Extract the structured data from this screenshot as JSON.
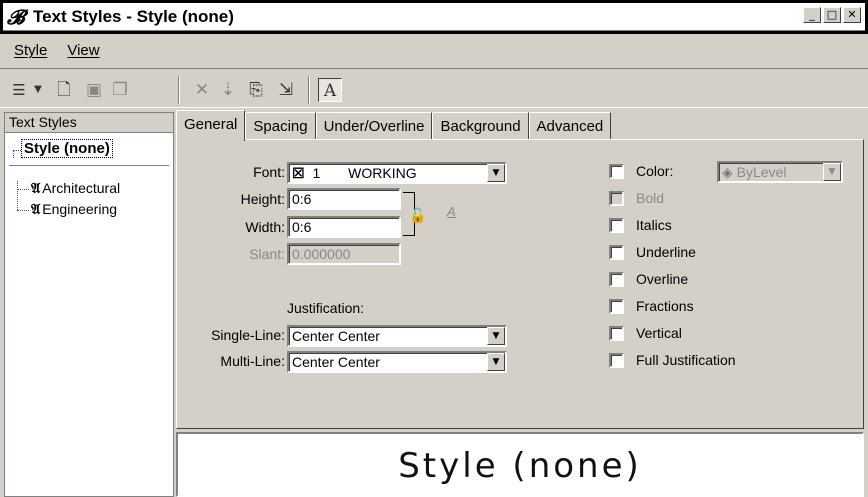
{
  "window": {
    "title": "Text Styles - Style (none)",
    "icon": "microstation-icon"
  },
  "menu": [
    {
      "label": "Style",
      "accel": "S"
    },
    {
      "label": "View",
      "accel": "V"
    }
  ],
  "tree": {
    "header": "Text Styles",
    "selected": "Style (none)",
    "items": [
      "Architectural",
      "Engineering"
    ]
  },
  "tabs": [
    "General",
    "Spacing",
    "Under/Overline",
    "Background",
    "Advanced"
  ],
  "general": {
    "font_label": "Font:",
    "font_number": "1",
    "font_name": "WORKING",
    "height_label": "Height:",
    "height_value": "0:6",
    "width_label": "Width:",
    "width_value": "0:6",
    "slant_label": "Slant:",
    "slant_value": "0.000000",
    "justification_label": "Justification:",
    "single_line_label": "Single-Line:",
    "single_line_value": "Center Center",
    "multi_line_label": "Multi-Line:",
    "multi_line_value": "Center Center",
    "color_value": "ByLevel"
  },
  "options": [
    {
      "label": "Color:",
      "checked": false,
      "enabled": true
    },
    {
      "label": "Bold",
      "checked": false,
      "enabled": false
    },
    {
      "label": "Italics",
      "checked": false,
      "enabled": true
    },
    {
      "label": "Underline",
      "checked": false,
      "enabled": true
    },
    {
      "label": "Overline",
      "checked": false,
      "enabled": true
    },
    {
      "label": "Fractions",
      "checked": false,
      "enabled": true
    },
    {
      "label": "Vertical",
      "checked": false,
      "enabled": true
    },
    {
      "label": "Full Justification",
      "checked": false,
      "enabled": true
    }
  ],
  "preview": {
    "text": "Style (none)"
  }
}
